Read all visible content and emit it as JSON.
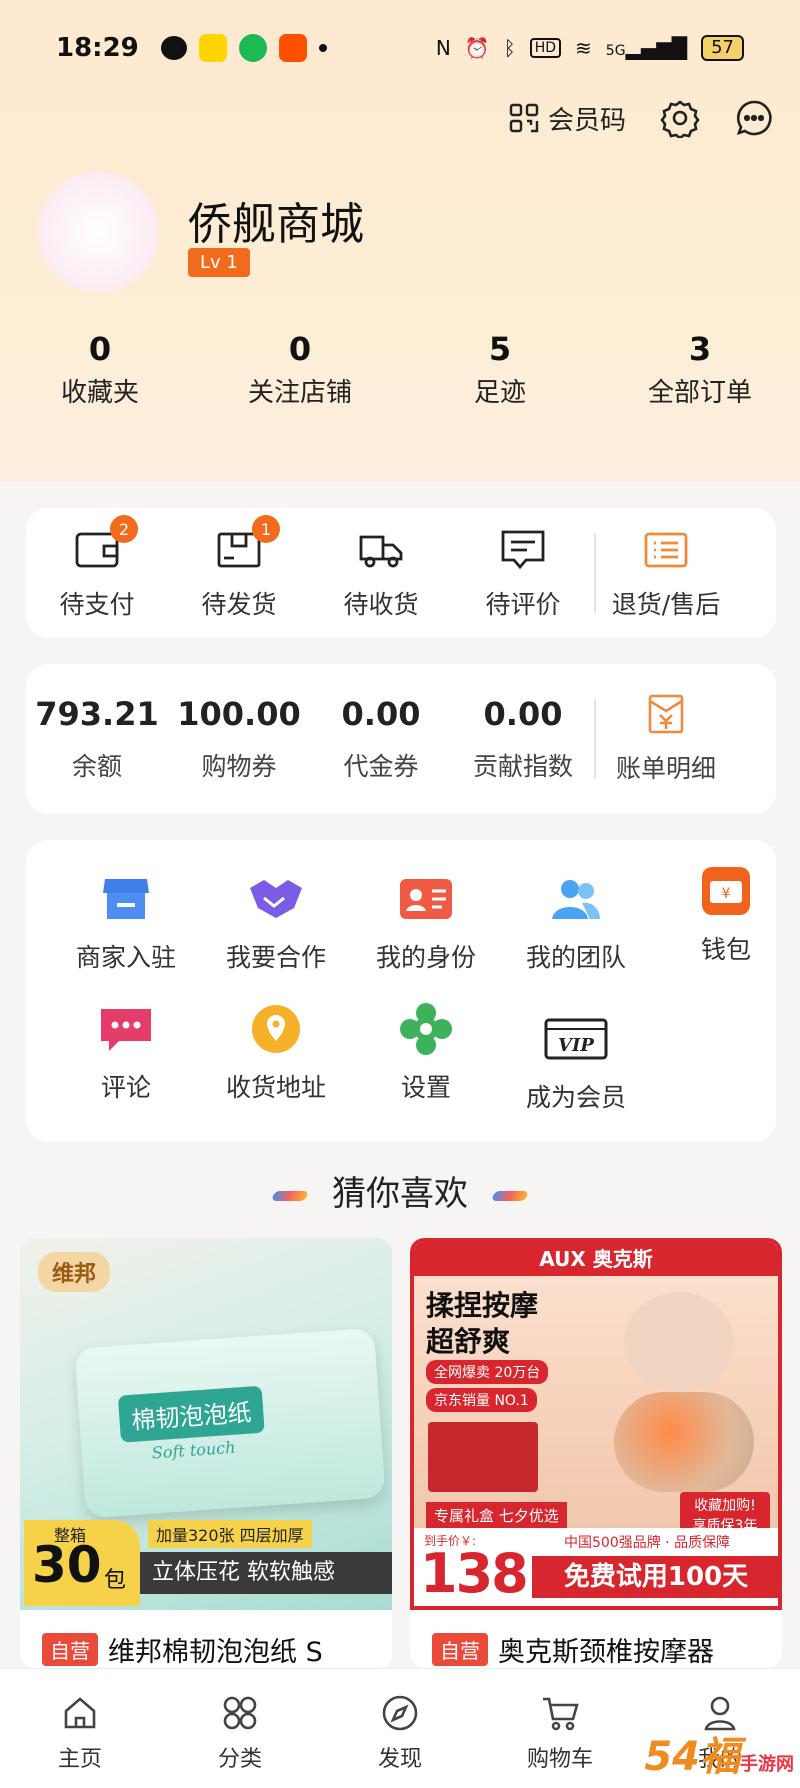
{
  "status_bar": {
    "time": "18:29",
    "battery": "57",
    "network": "5G"
  },
  "header": {
    "member_code_label": "会员码",
    "shop_name": "侨舰商城",
    "level": "Lv 1"
  },
  "stats": [
    {
      "num": "0",
      "label": "收藏夹"
    },
    {
      "num": "0",
      "label": "关注店铺"
    },
    {
      "num": "5",
      "label": "足迹"
    },
    {
      "num": "3",
      "label": "全部订单"
    }
  ],
  "orders": [
    {
      "label": "待支付",
      "badge": "2"
    },
    {
      "label": "待发货",
      "badge": "1"
    },
    {
      "label": "待收货"
    },
    {
      "label": "待评价"
    },
    {
      "label": "退货/售后"
    }
  ],
  "wallet": [
    {
      "num": "793.21",
      "label": "余额"
    },
    {
      "num": "100.00",
      "label": "购物券"
    },
    {
      "num": "0.00",
      "label": "代金券"
    },
    {
      "num": "0.00",
      "label": "贡献指数"
    },
    {
      "label": "账单明细"
    }
  ],
  "services": [
    {
      "label": "商家入驻"
    },
    {
      "label": "我要合作"
    },
    {
      "label": "我的身份"
    },
    {
      "label": "我的团队"
    },
    {
      "label": "钱包"
    },
    {
      "label": "评论"
    },
    {
      "label": "收货地址"
    },
    {
      "label": "设置"
    },
    {
      "label": "成为会员"
    }
  ],
  "guess_title": "猜你喜欢",
  "products": [
    {
      "tag": "自营",
      "title": "维邦棉韧泡泡纸 S",
      "brand": "维邦",
      "banner_main": "30",
      "banner_top": "整箱",
      "banner_unit": "包",
      "banner_sub1": "加量320张 四层加厚",
      "banner_sub2": "立体压花 软软触感",
      "pack_text": "棉韧泡泡纸",
      "pack_sub": "Soft touch"
    },
    {
      "tag": "自营",
      "title": "奥克斯颈椎按摩器",
      "brand": "AUX 奥克斯",
      "headline1": "揉捏按摩",
      "headline2": "超舒爽",
      "chip1": "全网爆卖 20万台",
      "chip2": "京东销量 NO.1",
      "gift": "专属礼盒 七夕优选",
      "promo": "收藏加购! 享质保3年",
      "price_label": "到手价￥:",
      "price": "138",
      "guarantee": "中国500强品牌 · 品质保障",
      "trial": "免费试用100天"
    }
  ],
  "tabbar": [
    {
      "label": "主页"
    },
    {
      "label": "分类"
    },
    {
      "label": "发现"
    },
    {
      "label": "购物车"
    },
    {
      "label": "我的"
    }
  ],
  "watermark": "54福",
  "watermark_sub": "手游网"
}
